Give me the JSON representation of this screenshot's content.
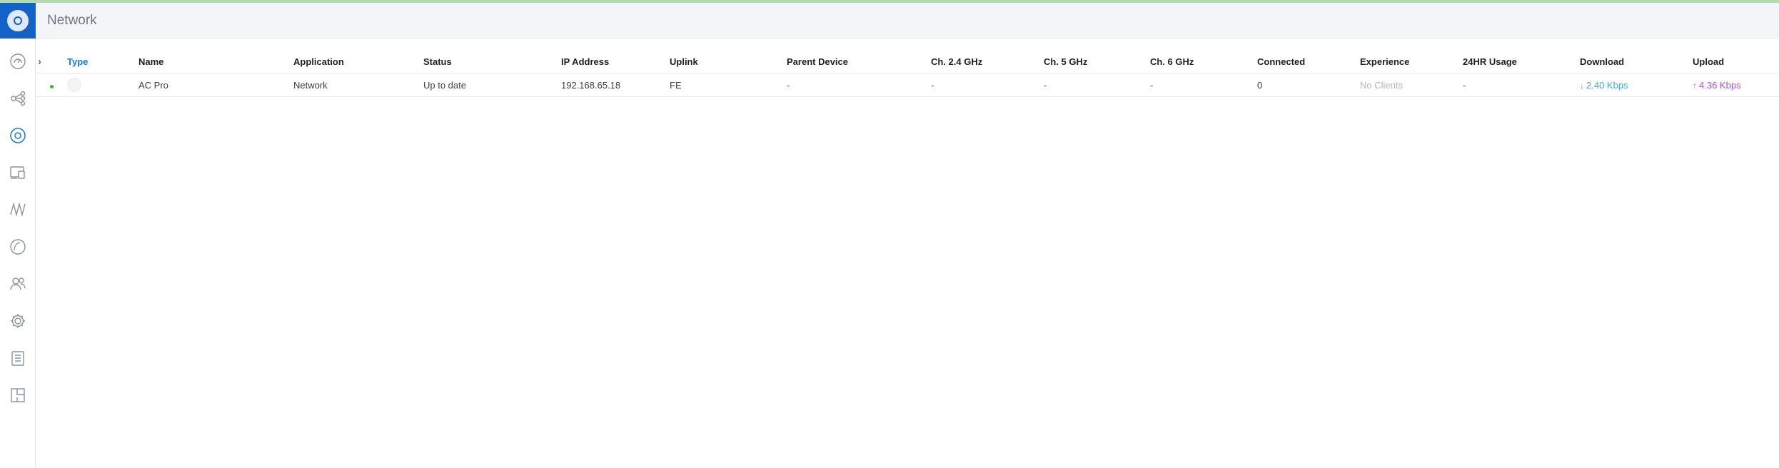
{
  "colors": {
    "brand": "#1262c8",
    "accent": "#1a7bd6",
    "online": "#37b24d",
    "download": "#37a9e8",
    "upload": "#b44be0"
  },
  "header": {
    "title": "Network"
  },
  "sidebar": {
    "items": [
      {
        "icon": "dashboard-icon"
      },
      {
        "icon": "topology-icon"
      },
      {
        "icon": "devices-icon",
        "active": true
      },
      {
        "icon": "clients-icon"
      },
      {
        "icon": "statistics-icon"
      },
      {
        "icon": "insights-icon"
      },
      {
        "icon": "users-icon"
      },
      {
        "icon": "settings-icon"
      },
      {
        "icon": "events-icon"
      },
      {
        "icon": "floorplan-icon"
      }
    ]
  },
  "table": {
    "columns": {
      "type": "Type",
      "name": "Name",
      "application": "Application",
      "status": "Status",
      "ip": "IP Address",
      "uplink": "Uplink",
      "parent": "Parent Device",
      "ch24": "Ch. 2.4 GHz",
      "ch5": "Ch. 5 GHz",
      "ch6": "Ch. 6 GHz",
      "connected": "Connected",
      "experience": "Experience",
      "usage": "24HR Usage",
      "download": "Download",
      "upload": "Upload"
    },
    "rows": [
      {
        "name": "AC Pro",
        "application": "Network",
        "status": "Up to date",
        "ip": "192.168.65.18",
        "uplink": "FE",
        "parent": "-",
        "ch24": "-",
        "ch5": "-",
        "ch6": "-",
        "connected": "0",
        "experience": "No Clients",
        "usage": "-",
        "download_arrow": "↓",
        "download": "2.40 Kbps",
        "upload_arrow": "↑",
        "upload": "4.36 Kbps"
      }
    ]
  }
}
